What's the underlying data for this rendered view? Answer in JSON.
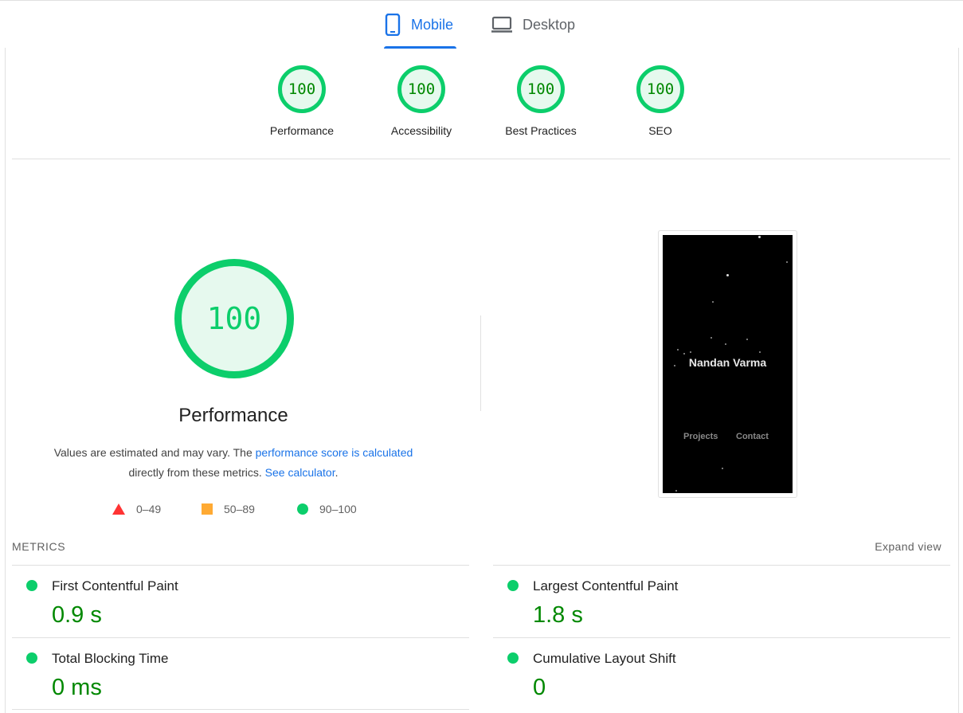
{
  "tabs": {
    "mobile_label": "Mobile",
    "desktop_label": "Desktop",
    "active": "Mobile"
  },
  "categories": [
    {
      "score": "100",
      "label": "Performance"
    },
    {
      "score": "100",
      "label": "Accessibility"
    },
    {
      "score": "100",
      "label": "Best Practices"
    },
    {
      "score": "100",
      "label": "SEO"
    }
  ],
  "performance": {
    "score": "100",
    "title": "Performance",
    "note_prefix": "Values are estimated and may vary. The ",
    "note_link": "performance score is calculated",
    "note_middle": "directly from these metrics.",
    "note_link2": "See calculator",
    "note_suffix": "."
  },
  "legend": {
    "fail": "0–49",
    "average": "50–89",
    "pass": "90–100"
  },
  "screenshot": {
    "name": "Nandan Varma",
    "link1": "Projects",
    "link2": "Contact"
  },
  "metrics": {
    "heading": "METRICS",
    "expand_label": "Expand view",
    "items": [
      {
        "name": "First Contentful Paint",
        "value": "0.9 s"
      },
      {
        "name": "Largest Contentful Paint",
        "value": "1.8 s"
      },
      {
        "name": "Total Blocking Time",
        "value": "0 ms"
      },
      {
        "name": "Cumulative Layout Shift",
        "value": "0"
      }
    ]
  },
  "colors": {
    "pass": "#0cce6b",
    "pass_text": "#008800",
    "average": "#ffaa33",
    "fail": "#ff3333",
    "accent": "#1a73e8"
  }
}
